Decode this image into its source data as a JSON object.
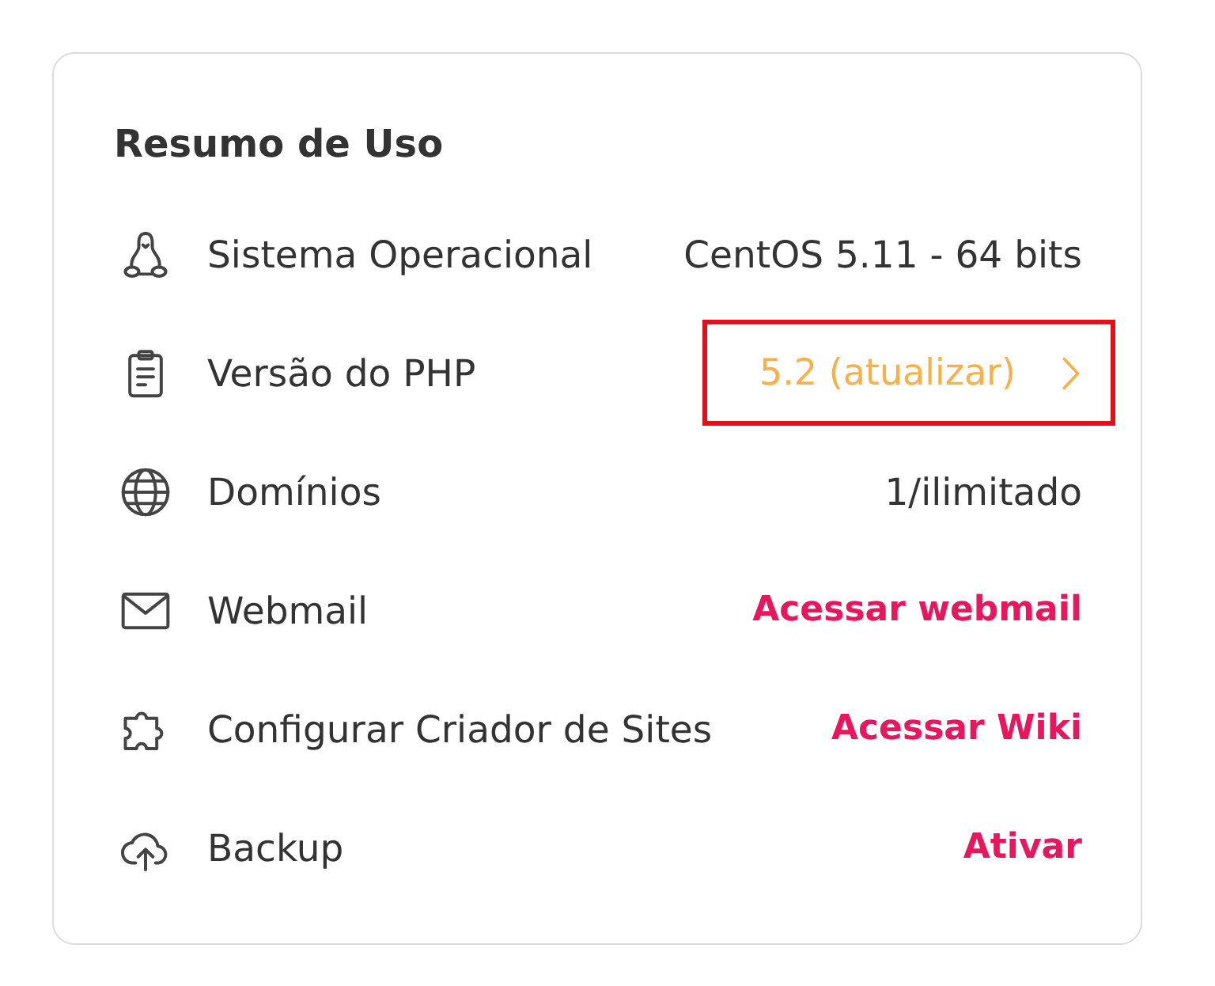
{
  "card": {
    "title": "Resumo de Uso",
    "rows": [
      {
        "label": "Sistema Operacional",
        "value": {
          "kind": "text",
          "text": "CentOS 5.11 - 64 bits"
        },
        "highlighted": false
      },
      {
        "label": "Versão do PHP",
        "value": {
          "kind": "update",
          "text": "5.2 (atualizar)"
        },
        "highlighted": true
      },
      {
        "label": "Domínios",
        "value": {
          "kind": "text",
          "text": "1/ilimitado"
        },
        "highlighted": false
      },
      {
        "label": "Webmail",
        "value": {
          "kind": "link",
          "text": "Acessar webmail"
        },
        "highlighted": false
      },
      {
        "label": "Configurar Criador de Sites",
        "value": {
          "kind": "link",
          "text": "Acessar Wiki"
        },
        "highlighted": false
      },
      {
        "label": "Backup",
        "value": {
          "kind": "link",
          "text": "Ativar"
        },
        "highlighted": false
      }
    ]
  }
}
